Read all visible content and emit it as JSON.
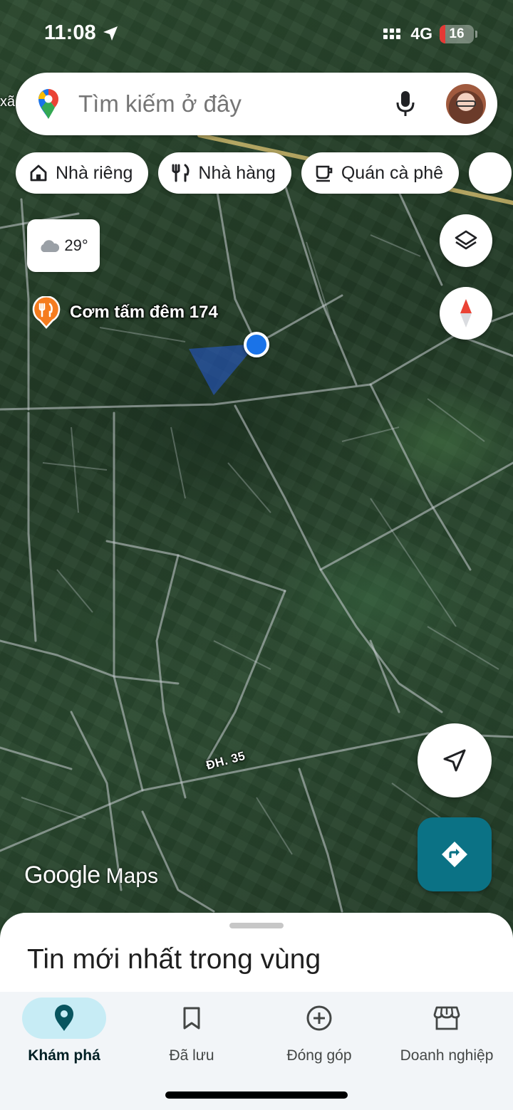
{
  "status_bar": {
    "time": "11:08",
    "network": "4G",
    "battery_level": "16",
    "battery_fraction": 0.16,
    "battery_color": "#e53935"
  },
  "search": {
    "placeholder": "Tìm kiếm ở đây",
    "logo_icon": "google-maps-pin-icon",
    "mic_icon": "mic-icon"
  },
  "chips": [
    {
      "label": "Nhà riêng",
      "icon": "home-icon"
    },
    {
      "label": "Nhà hàng",
      "icon": "restaurant-icon"
    },
    {
      "label": "Quán cà phê",
      "icon": "coffee-icon"
    }
  ],
  "map": {
    "edge_label": "xã",
    "weather_temp": "29°",
    "weather_icon": "cloud-icon",
    "poi_name": "Cơm tấm đêm 174",
    "poi_icon": "restaurant-pin-icon",
    "road_label": "ĐH. 35",
    "watermark_google": "Google",
    "watermark_maps": "Maps"
  },
  "controls": {
    "layers_icon": "layers-icon",
    "compass_icon": "compass-icon",
    "locate_icon": "navigation-arrow-icon",
    "directions_icon": "directions-icon",
    "accent": "#0b7285"
  },
  "sheet": {
    "title": "Tin mới nhất trong vùng"
  },
  "nav": [
    {
      "label": "Khám phá",
      "icon": "explore-pin-icon",
      "active": true
    },
    {
      "label": "Đã lưu",
      "icon": "bookmark-icon",
      "active": false
    },
    {
      "label": "Đóng góp",
      "icon": "add-circle-icon",
      "active": false
    },
    {
      "label": "Doanh nghiệp",
      "icon": "storefront-icon",
      "active": false
    }
  ]
}
